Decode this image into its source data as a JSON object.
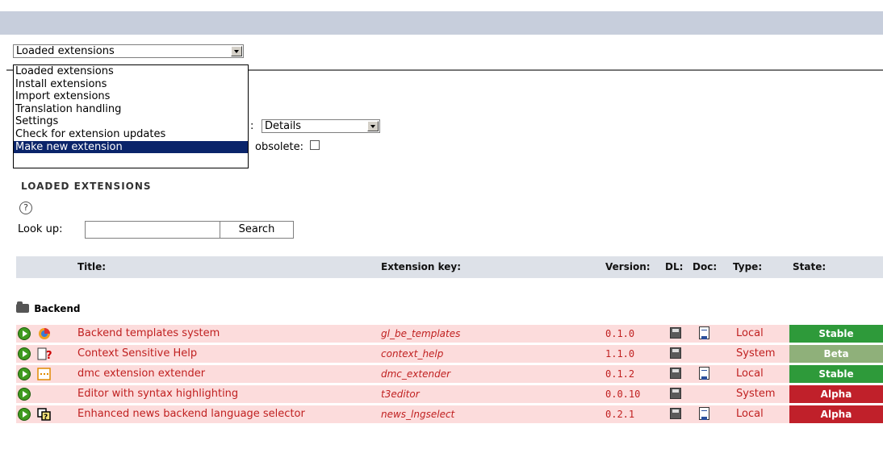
{
  "menu": {
    "selected": "Loaded extensions",
    "options": [
      "Loaded extensions",
      "Install extensions",
      "Import extensions",
      "Translation handling",
      "Settings",
      "Check for extension updates",
      "Make new extension"
    ],
    "highlighted_index": 6
  },
  "display": {
    "select_value": "Details",
    "obsolete_label": "obsolete:"
  },
  "section": {
    "title": "LOADED EXTENSIONS",
    "help_glyph": "?"
  },
  "lookup": {
    "label": "Look up:",
    "value": "",
    "search_label": "Search"
  },
  "table": {
    "headers": {
      "title": "Title:",
      "key": "Extension key:",
      "version": "Version:",
      "dl": "DL:",
      "doc": "Doc:",
      "type": "Type:",
      "state": "State:"
    },
    "category": "Backend",
    "rows": [
      {
        "title": "Backend templates system",
        "key": "gl_be_templates",
        "version": "0.1.0",
        "type": "Local",
        "state": "Stable"
      },
      {
        "title": "Context Sensitive Help",
        "key": "context_help",
        "version": "1.1.0",
        "type": "System",
        "state": "Beta"
      },
      {
        "title": "dmc extension extender",
        "key": "dmc_extender",
        "version": "0.1.2",
        "type": "Local",
        "state": "Stable"
      },
      {
        "title": "Editor with syntax highlighting",
        "key": "t3editor",
        "version": "0.0.10",
        "type": "System",
        "state": "Alpha"
      },
      {
        "title": "Enhanced news backend language selector",
        "key": "news_lngselect",
        "version": "0.2.1",
        "type": "Local",
        "state": "Alpha"
      }
    ]
  },
  "colors": {
    "stable": "#2e9a3a",
    "beta": "#8fb07a",
    "alpha": "#c0202a",
    "row_bg": "#fcdcdc",
    "link": "#c02020",
    "menu_highlight": "#0a246a"
  }
}
